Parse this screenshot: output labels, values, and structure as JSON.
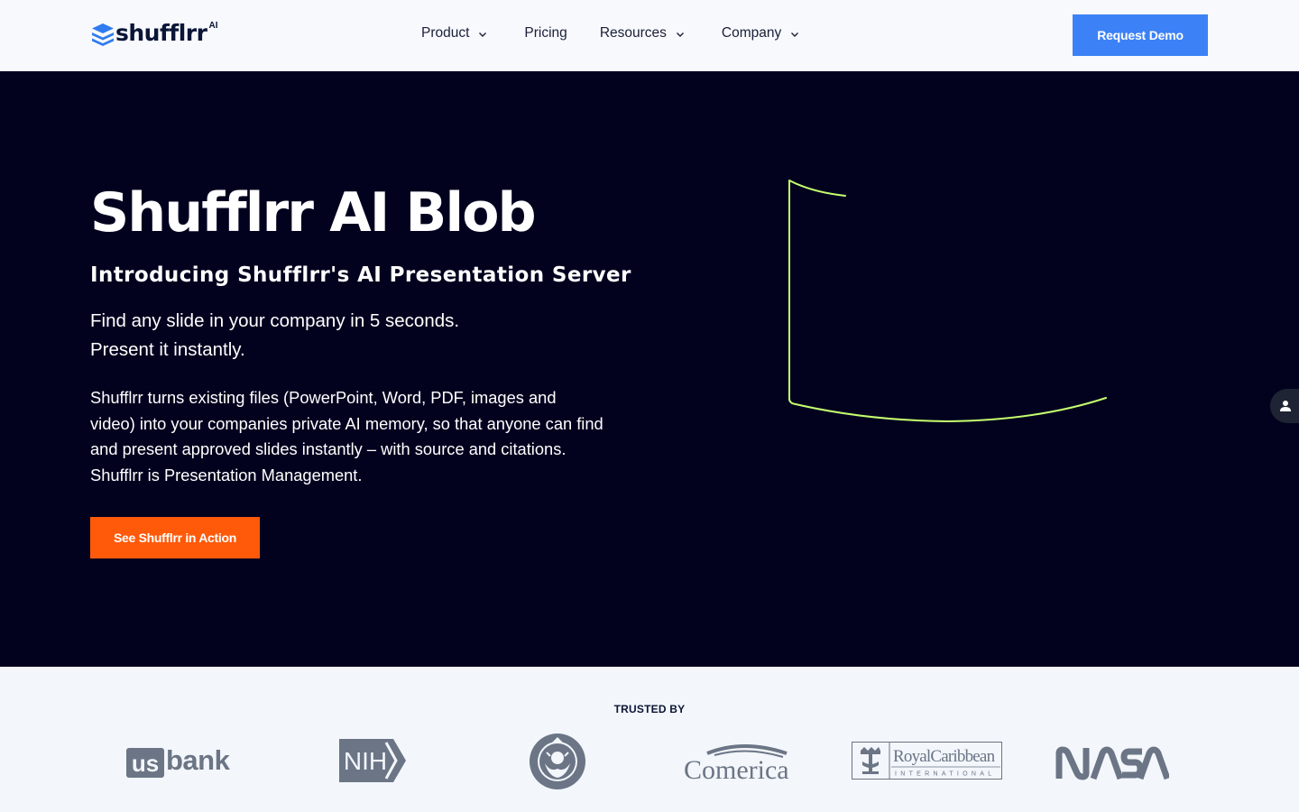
{
  "header": {
    "logo_text": "shufflrr",
    "logo_sup": "AI",
    "nav": [
      {
        "label": "Product",
        "has_dropdown": true
      },
      {
        "label": "Pricing",
        "has_dropdown": false
      },
      {
        "label": "Resources",
        "has_dropdown": true
      },
      {
        "label": "Company",
        "has_dropdown": true
      }
    ],
    "cta_label": "Request Demo"
  },
  "hero": {
    "title": "Shufflrr AI Blob",
    "subtitle": "Introducing Shufflrr's AI Presentation Server",
    "lead_line1": "Find any slide in your company in 5 seconds.",
    "lead_line2": "Present it instantly.",
    "body": "Shufflrr turns existing files (PowerPoint, Word, PDF, images and video) into your companies private AI memory, so that anyone can find and present approved slides instantly – with source and citations.  Shufflrr is Presentation Management.",
    "cta_label": "See Shufflrr in Action"
  },
  "trusted": {
    "label": "TRUSTED BY",
    "logos": [
      {
        "name": "us bank",
        "text_a": "us",
        "text_b": "bank"
      },
      {
        "name": "NIH",
        "text": "NIH"
      },
      {
        "name": "Starbucks"
      },
      {
        "name": "Comerica",
        "text": "Comerica"
      },
      {
        "name": "Royal Caribbean International",
        "text_a": "RoyalCaribbean",
        "text_b": "INTERNATIONAL"
      },
      {
        "name": "NASA",
        "text": "NASA"
      }
    ]
  },
  "colors": {
    "hero_bg": "#02021f",
    "accent_blue": "#3c82f6",
    "accent_orange": "#ff5a0a",
    "blob_stroke": "#c6ff6e",
    "logo_gray": "#6b7585"
  },
  "icons": {
    "logo_mark": "layers-logo-icon",
    "chevron": "chevron-down-icon",
    "side_tab": "user-icon"
  }
}
